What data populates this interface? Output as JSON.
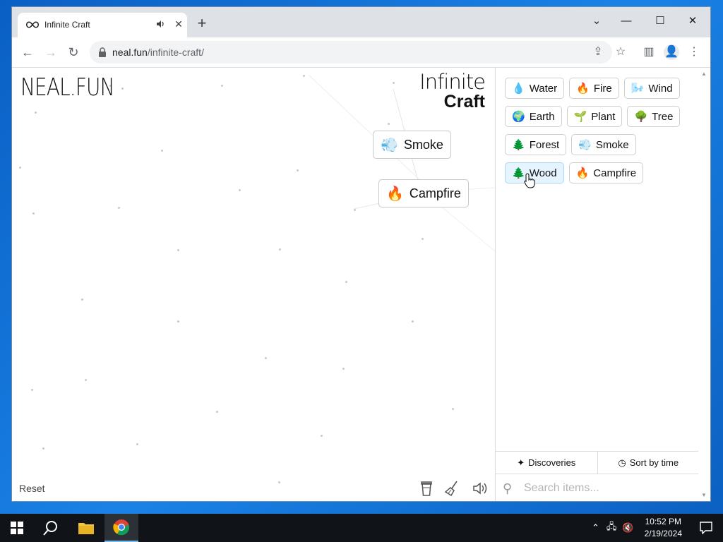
{
  "browser": {
    "tab_title": "Infinite Craft",
    "new_tab_label": "+",
    "url_host": "neal.fun",
    "url_path": "/infinite-craft/"
  },
  "page": {
    "logo_left": "NEAL.FUN",
    "logo_right_line1": "Infinite",
    "logo_right_line2": "Craft",
    "reset_label": "Reset",
    "canvas_items": [
      {
        "emoji": "💨",
        "label": "Smoke"
      },
      {
        "emoji": "🔥",
        "label": "Campfire"
      }
    ]
  },
  "sidebar": {
    "items": [
      {
        "emoji": "💧",
        "label": "Water"
      },
      {
        "emoji": "🔥",
        "label": "Fire"
      },
      {
        "emoji": "🌬️",
        "label": "Wind"
      },
      {
        "emoji": "🌍",
        "label": "Earth"
      },
      {
        "emoji": "🌱",
        "label": "Plant"
      },
      {
        "emoji": "🌳",
        "label": "Tree"
      },
      {
        "emoji": "🌲",
        "label": "Forest"
      },
      {
        "emoji": "💨",
        "label": "Smoke"
      },
      {
        "emoji": "🌲",
        "label": "Wood"
      },
      {
        "emoji": "🔥",
        "label": "Campfire"
      }
    ],
    "discoveries_label": "Discoveries",
    "sort_label": "Sort by time",
    "search_placeholder": "Search items..."
  },
  "taskbar": {
    "time": "10:52 PM",
    "date": "2/19/2024"
  }
}
